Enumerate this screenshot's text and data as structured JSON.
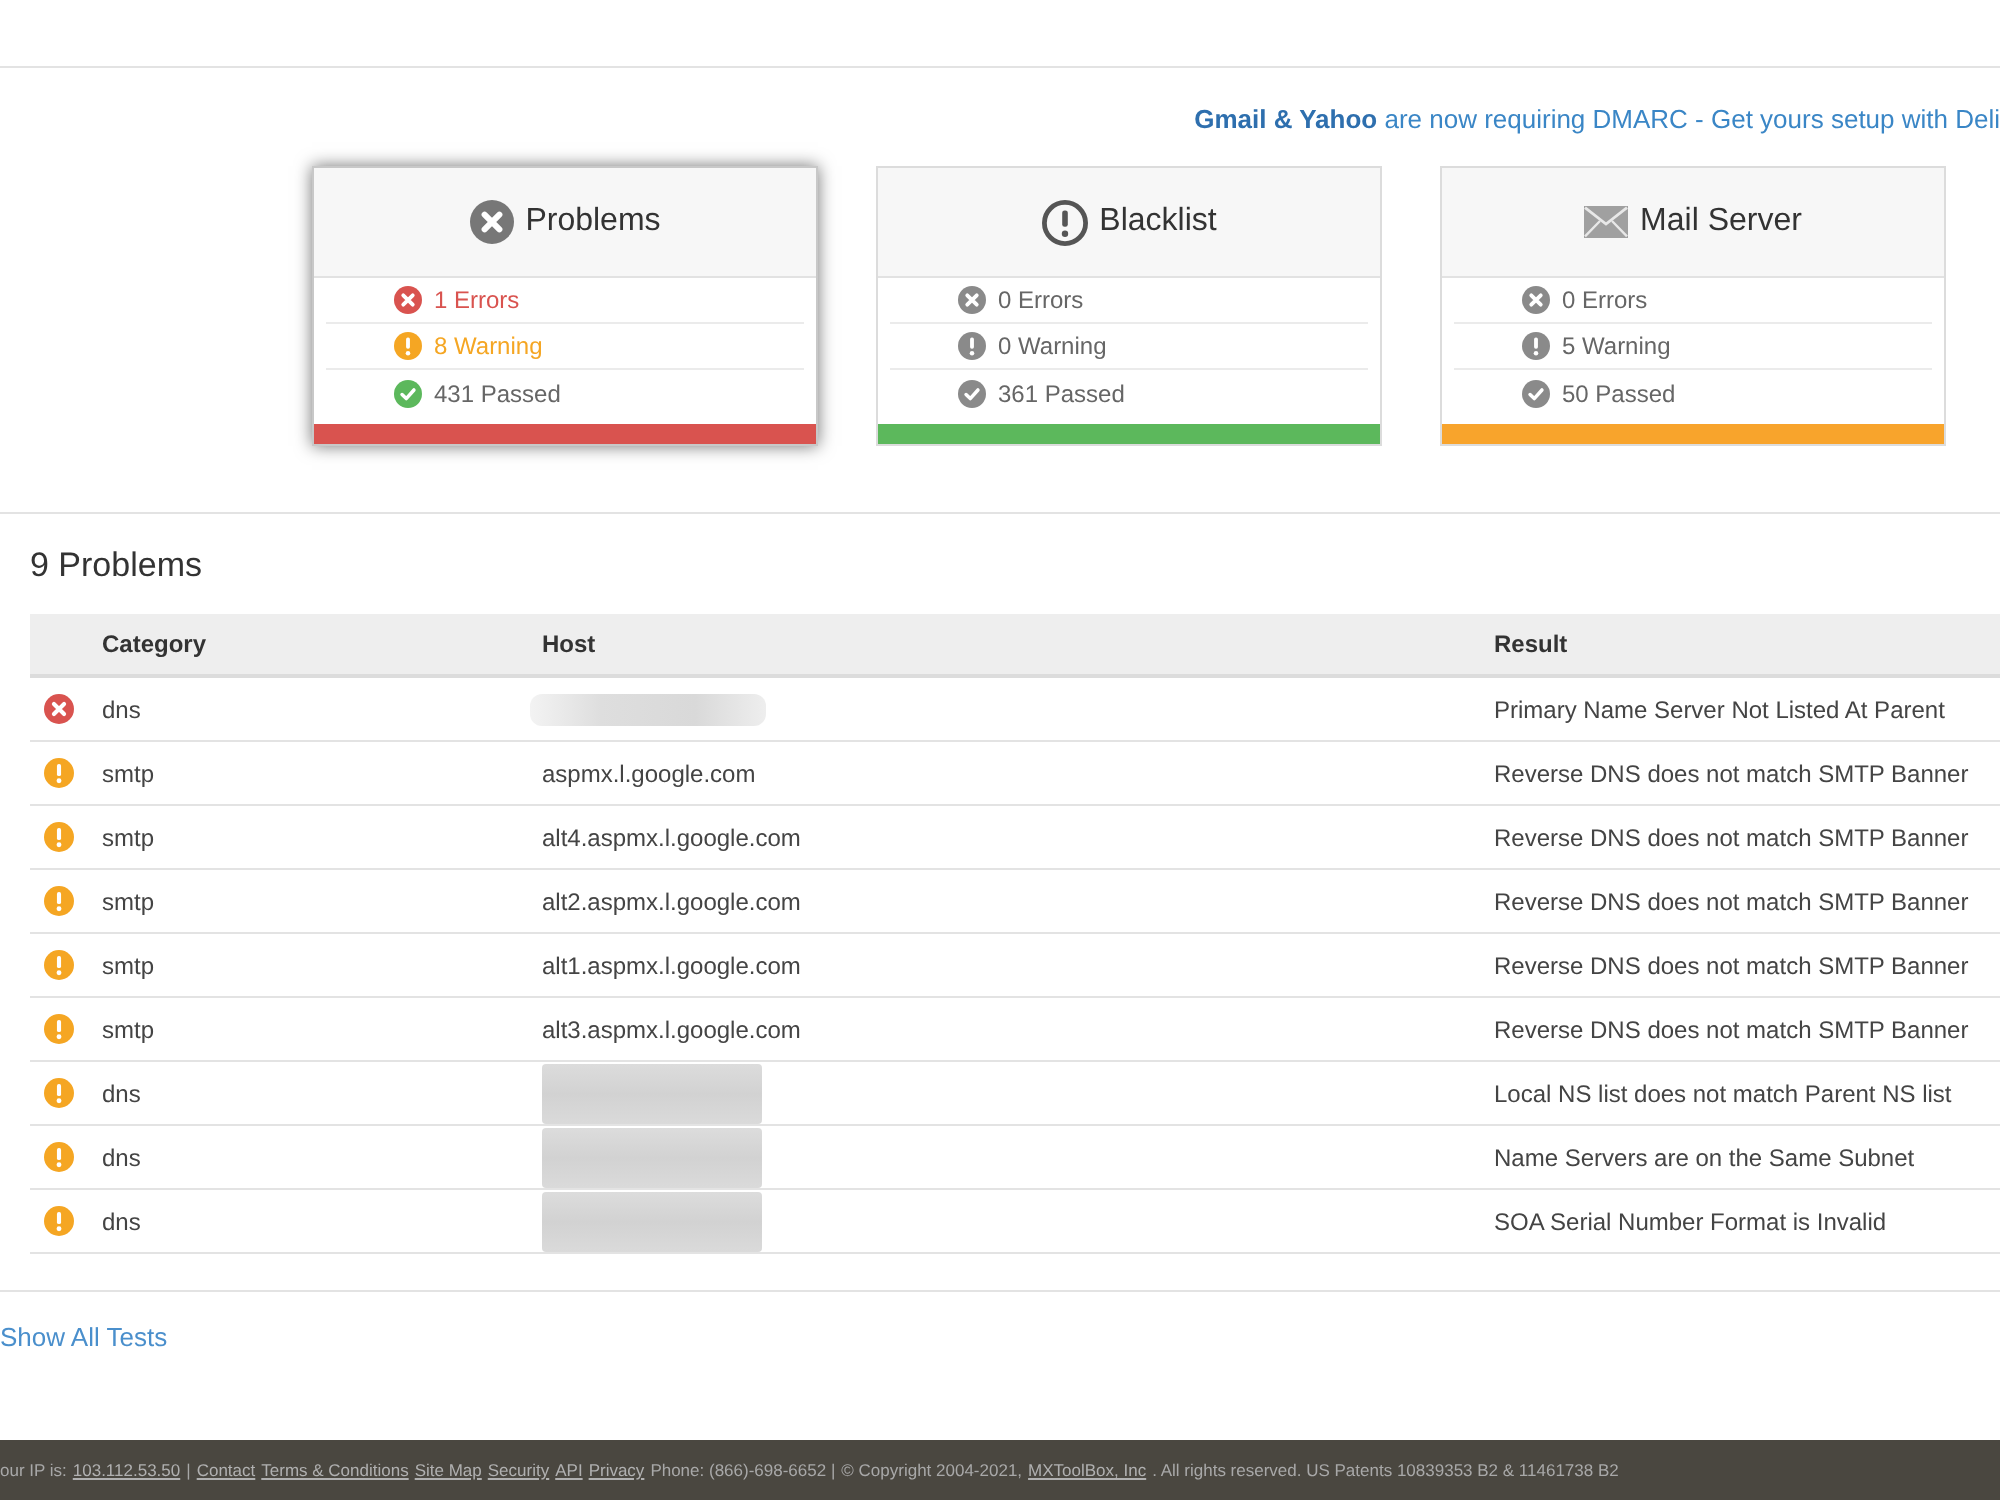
{
  "banner": {
    "text": "**Gmail & Yahoo** are now requiring DMARC - Get yours setup with Deli"
  },
  "cards": [
    {
      "kind": "problems",
      "title": "Problems",
      "selected": true,
      "color": "#d9534f",
      "rows": [
        {
          "kind": "error",
          "text": "1 Errors"
        },
        {
          "kind": "warning",
          "text": "8 Warning"
        },
        {
          "kind": "passed",
          "text": "431 Passed"
        }
      ]
    },
    {
      "kind": "blacklist",
      "title": "Blacklist",
      "selected": false,
      "color": "#5cb85c",
      "rows": [
        {
          "kind": "error",
          "text": "0 Errors"
        },
        {
          "kind": "warning",
          "text": "0 Warning"
        },
        {
          "kind": "passed",
          "text": "361 Passed"
        }
      ]
    },
    {
      "kind": "mail_server",
      "title": "Mail Server",
      "selected": false,
      "color": "#f8a42c",
      "rows": [
        {
          "kind": "error",
          "text": "0 Errors"
        },
        {
          "kind": "warning",
          "text": "5 Warning"
        },
        {
          "kind": "passed",
          "text": "50 Passed"
        }
      ]
    }
  ],
  "problems": {
    "heading": "9 Problems",
    "table": {
      "columns": [
        "Category",
        "Host",
        "Result"
      ],
      "rows": [
        {
          "kind": "error",
          "category": "dns",
          "host_blurred": true,
          "result": "Primary Name Server Not Listed At Parent"
        },
        {
          "kind": "warning",
          "category": "smtp",
          "host_blurred": false,
          "host": "aspmx.l.google.com",
          "result": "Reverse DNS does not match SMTP Banner"
        },
        {
          "kind": "warning",
          "category": "smtp",
          "host_blurred": false,
          "host": "alt4.aspmx.l.google.com",
          "result": "Reverse DNS does not match SMTP Banner"
        },
        {
          "kind": "warning",
          "category": "smtp",
          "host_blurred": false,
          "host": "alt2.aspmx.l.google.com",
          "result": "Reverse DNS does not match SMTP Banner"
        },
        {
          "kind": "warning",
          "category": "smtp",
          "host_blurred": false,
          "host": "alt1.aspmx.l.google.com",
          "result": "Reverse DNS does not match SMTP Banner"
        },
        {
          "kind": "warning",
          "category": "smtp",
          "host_blurred": false,
          "host": "alt3.aspmx.l.google.com",
          "result": "Reverse DNS does not match SMTP Banner"
        },
        {
          "kind": "warning",
          "category": "dns",
          "host_blurred": true,
          "result": "Local NS list does not match Parent NS list"
        },
        {
          "kind": "warning",
          "category": "dns",
          "host_blurred": true,
          "result": "Name Servers are on the Same Subnet"
        },
        {
          "kind": "warning",
          "category": "dns",
          "host_blurred": true,
          "result": "SOA Serial Number Format is Invalid"
        }
      ]
    }
  },
  "show_all_link": "Show All Tests",
  "footer": {
    "items": [
      {
        "kind": "text",
        "text": "our IP is:"
      },
      {
        "kind": "link",
        "text": "103.112.53.50"
      },
      {
        "kind": "text",
        "text": "|"
      },
      {
        "kind": "link",
        "text": "Contact"
      },
      {
        "kind": "link",
        "text": "Terms & Conditions"
      },
      {
        "kind": "link",
        "text": "Site Map"
      },
      {
        "kind": "link",
        "text": "Security"
      },
      {
        "kind": "link",
        "text": "API"
      },
      {
        "kind": "link",
        "text": "Privacy"
      },
      {
        "kind": "text",
        "text": "Phone: (866)-698-6652 |"
      },
      {
        "kind": "text",
        "text": "© Copyright 2004-2021,"
      },
      {
        "kind": "link",
        "text": "MXToolBox, Inc"
      },
      {
        "kind": "text",
        "text": ". All rights reserved. US Patents 10839353 B2 & 11461738 B2"
      }
    ]
  }
}
